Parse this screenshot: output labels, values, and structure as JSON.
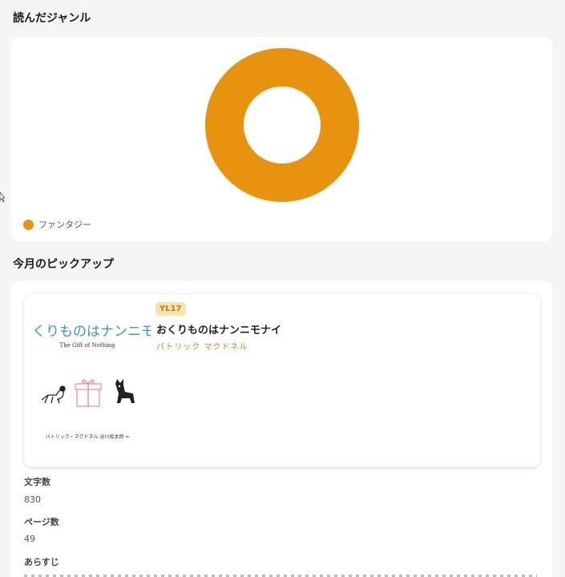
{
  "genre_section": {
    "title": "読んだジャンル",
    "legend": [
      {
        "label": "ファンタジー",
        "color": "#E8930F"
      }
    ]
  },
  "chart_data": {
    "type": "pie",
    "categories": [
      "ファンタジー"
    ],
    "values": [
      1
    ],
    "colors": [
      "#E8930F"
    ],
    "donut": true,
    "legend_position": "bottom-left"
  },
  "pickup_section": {
    "title": "今月のピックアップ",
    "book": {
      "level_badge": "YL17",
      "title": "おくりものはナンニモナイ",
      "author": "パトリック マクドネル",
      "cover": {
        "title": "くりものはナンニモナ",
        "subtitle": "The Gift of Nothing",
        "author": "パトリック・マクドネル 谷川俊太郎 ="
      }
    },
    "fields": {
      "char_count_label": "文字数",
      "char_count_value": "830",
      "page_count_label": "ページ数",
      "page_count_value": "49",
      "synopsis_label": "あらすじ"
    }
  }
}
